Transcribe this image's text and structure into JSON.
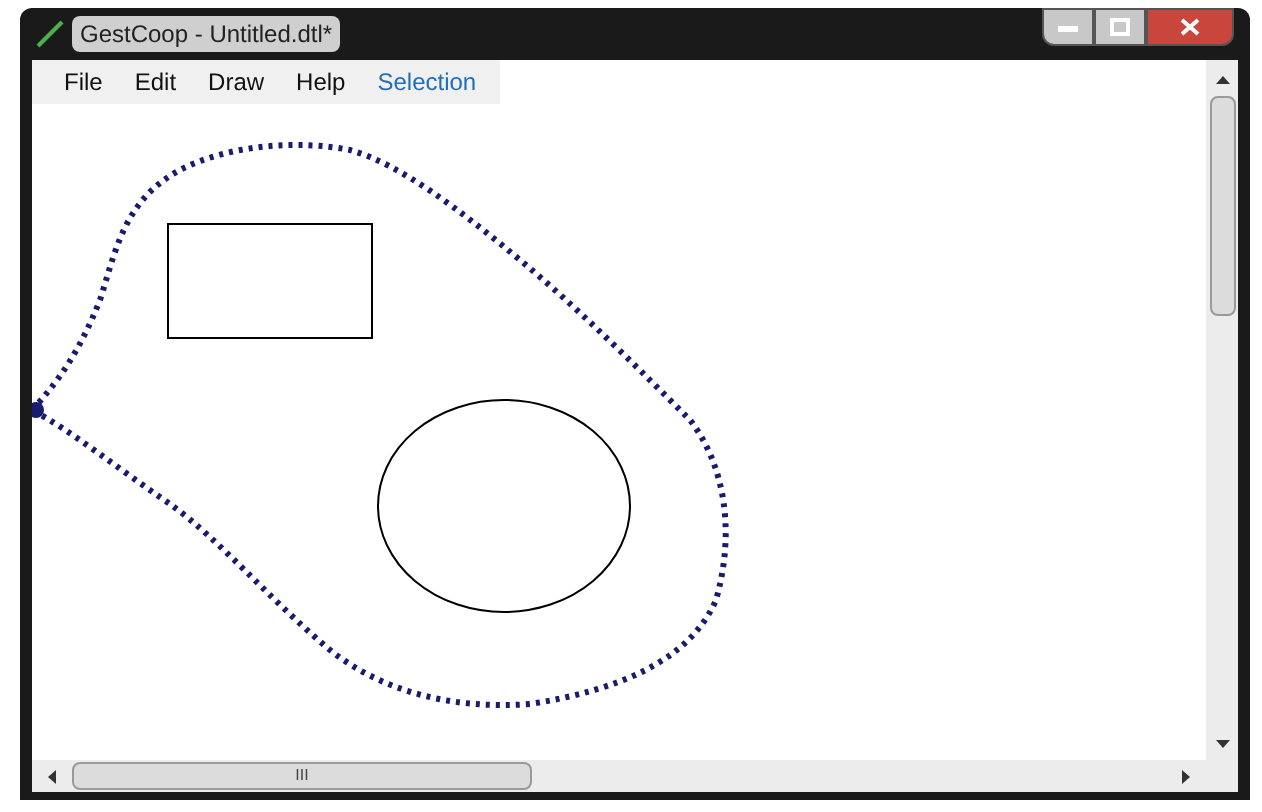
{
  "window": {
    "title": "GestCoop - Untitled.dtl*"
  },
  "menu": [
    {
      "label": "File",
      "selected": false
    },
    {
      "label": "Edit",
      "selected": false
    },
    {
      "label": "Draw",
      "selected": false
    },
    {
      "label": "Help",
      "selected": false
    },
    {
      "label": "Selection",
      "selected": true
    }
  ],
  "scrollbar_label": "III"
}
